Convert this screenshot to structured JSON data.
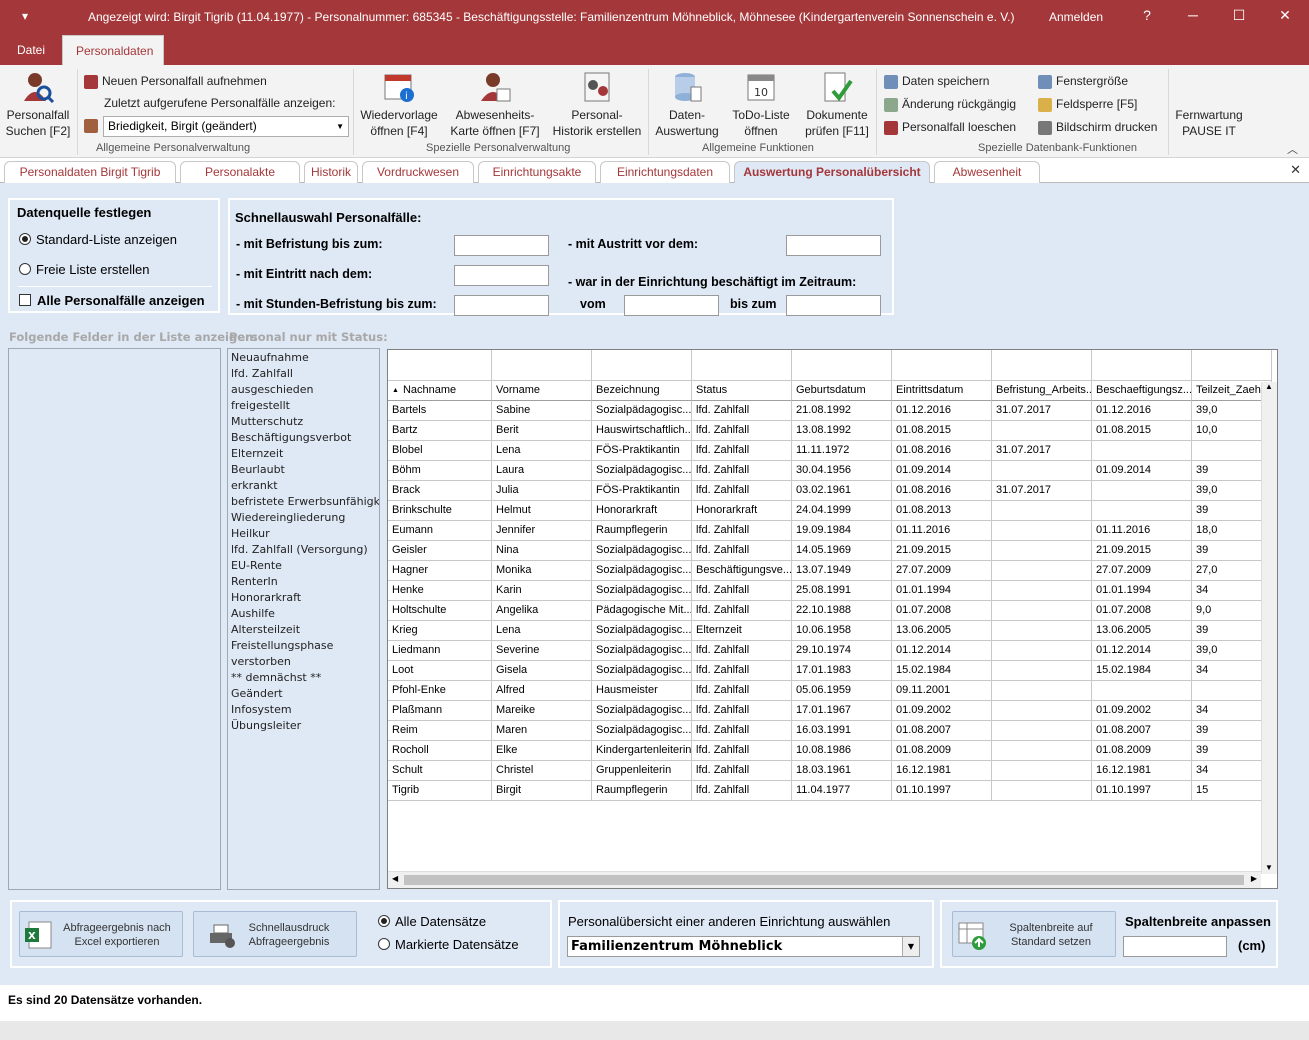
{
  "titlebar": {
    "quick_access": "▾",
    "title": "Angezeigt wird: Birgit Tigrib (11.04.1977) - Personalnummer: 685345 - Beschäftigungsstelle: Familienzentrum Möhneblick, Möhnesee (Kindergartenverein Sonnenschein e. V.)",
    "login": "Anmelden",
    "help": "?",
    "minimize": "─",
    "maximize": "☐",
    "close": "✕"
  },
  "menu": {
    "datei": "Datei",
    "personaldaten": "Personaldaten"
  },
  "ribbon": {
    "personalfall_suchen": [
      "Personalfall",
      "Suchen [F2]"
    ],
    "neuen_personalfall": "Neuen Personalfall aufnehmen",
    "zuletzt": "Zuletzt aufgerufene Personalfälle anzeigen:",
    "combo_value": "Briedigkeit, Birgit (geändert)",
    "wiedervorlage": [
      "Wiedervorlage",
      "öffnen [F4]"
    ],
    "abwesenheit": [
      "Abwesenheits-",
      "Karte öffnen [F7]"
    ],
    "historik": [
      "Personal-",
      "Historik erstellen"
    ],
    "daten_auswertung": [
      "Daten-",
      "Auswertung"
    ],
    "todo": [
      "ToDo-Liste",
      "öffnen"
    ],
    "dokumente": [
      "Dokumente",
      "prüfen [F11]"
    ],
    "daten_speichern": "Daten speichern",
    "aenderung": "Änderung rückgängig",
    "loeschen": "Personalfall loeschen",
    "fenstergroesse": "Fenstergröße",
    "feldsperre": "Feldsperre [F5]",
    "bildschirm": "Bildschirm drucken",
    "fernwartung": [
      "Fernwartung",
      "PAUSE IT"
    ],
    "groups": {
      "allgemeine_personal": "Allgemeine Personalverwaltung",
      "spezielle_personal": "Spezielle Personalverwaltung",
      "allgemeine_funktionen": "Allgemeine Funktionen",
      "spezielle_db": "Spezielle Datenbank-Funktionen"
    }
  },
  "doctabs": [
    "Personaldaten Birgit Tigrib",
    "Personalakte",
    "Historik",
    "Vordruckwesen",
    "Einrichtungsakte",
    "Einrichtungsdaten",
    "Auswertung Personalübersicht",
    "Abwesenheit"
  ],
  "datenquelle": {
    "title": "Datenquelle festlegen",
    "standard": "Standard-Liste anzeigen",
    "frei": "Freie Liste erstellen",
    "alle": "Alle Personalfälle anzeigen"
  },
  "schnell": {
    "title": "Schnellauswahl Personalfälle:",
    "befristung": "- mit Befristung bis zum:",
    "eintritt": "- mit Eintritt nach dem:",
    "stunden": "- mit Stunden-Befristung bis zum:",
    "austritt": "- mit Austritt vor dem:",
    "zeitraum": "- war in der Einrichtung beschäftigt im Zeitraum:",
    "vom": "vom",
    "bis": "bis zum"
  },
  "felder_label": "Folgende Felder in der Liste anzeigen:",
  "status_label": "Personal nur mit Status:",
  "status_items": [
    "Neuaufnahme",
    "lfd. Zahlfall",
    "ausgeschieden",
    "freigestellt",
    "Mutterschutz",
    "Beschäftigungsverbot",
    "Elternzeit",
    "Beurlaubt",
    "erkrankt",
    "befristete Erwerbsunfähigk",
    "Wiedereingliederung",
    "Heilkur",
    "lfd. Zahlfall (Versorgung)",
    "EU-Rente",
    "RenterIn",
    "Honorarkraft",
    "Aushilfe",
    "Altersteilzeit",
    "Freistellungsphase",
    "verstorben",
    "** demnächst **",
    "Geändert",
    "Infosystem",
    "Übungsleiter"
  ],
  "table": {
    "sort_indicator": "▲",
    "columns": [
      "Nachname",
      "Vorname",
      "Bezeichnung",
      "Status",
      "Geburtsdatum",
      "Eintrittsdatum",
      "Befristung_Arbeits...",
      "Beschaeftigungsz...",
      "Teilzeit_Zaeh"
    ],
    "rows": [
      [
        "Bartels",
        "Sabine",
        "Sozialpädagogisc...",
        "lfd. Zahlfall",
        "21.08.1992",
        "01.12.2016",
        "31.07.2017",
        "01.12.2016",
        "39,0"
      ],
      [
        "Bartz",
        "Berit",
        "Hauswirtschaftlich...",
        "lfd. Zahlfall",
        "13.08.1992",
        "01.08.2015",
        "",
        "01.08.2015",
        "10,0"
      ],
      [
        "Blobel",
        "Lena",
        "FÖS-Praktikantin",
        "lfd. Zahlfall",
        "11.11.1972",
        "01.08.2016",
        "31.07.2017",
        "",
        ""
      ],
      [
        "Böhm",
        "Laura",
        "Sozialpädagogisc...",
        "lfd. Zahlfall",
        "30.04.1956",
        "01.09.2014",
        "",
        "01.09.2014",
        "39"
      ],
      [
        "Brack",
        "Julia",
        "FÖS-Praktikantin",
        "lfd. Zahlfall",
        "03.02.1961",
        "01.08.2016",
        "31.07.2017",
        "",
        "39,0"
      ],
      [
        "Brinkschulte",
        "Helmut",
        "Honorarkraft",
        "Honorarkraft",
        "24.04.1999",
        "01.08.2013",
        "",
        "",
        "39"
      ],
      [
        "Eumann",
        "Jennifer",
        "Raumpflegerin",
        "lfd. Zahlfall",
        "19.09.1984",
        "01.11.2016",
        "",
        "01.11.2016",
        "18,0"
      ],
      [
        "Geisler",
        "Nina",
        "Sozialpädagogisc...",
        "lfd. Zahlfall",
        "14.05.1969",
        "21.09.2015",
        "",
        "21.09.2015",
        "39"
      ],
      [
        "Hagner",
        "Monika",
        "Sozialpädagogisc...",
        "Beschäftigungsve...",
        "13.07.1949",
        "27.07.2009",
        "",
        "27.07.2009",
        "27,0"
      ],
      [
        "Henke",
        "Karin",
        "Sozialpädagogisc...",
        "lfd. Zahlfall",
        "25.08.1991",
        "01.01.1994",
        "",
        "01.01.1994",
        "34"
      ],
      [
        "Holtschulte",
        "Angelika",
        "Pädagogische Mit...",
        "lfd. Zahlfall",
        "22.10.1988",
        "01.07.2008",
        "",
        "01.07.2008",
        "9,0"
      ],
      [
        "Krieg",
        "Lena",
        "Sozialpädagogisc...",
        "Elternzeit",
        "10.06.1958",
        "13.06.2005",
        "",
        "13.06.2005",
        "39"
      ],
      [
        "Liedmann",
        "Severine",
        "Sozialpädagogisc...",
        "lfd. Zahlfall",
        "29.10.1974",
        "01.12.2014",
        "",
        "01.12.2014",
        "39,0"
      ],
      [
        "Loot",
        "Gisela",
        "Sozialpädagogisc...",
        "lfd. Zahlfall",
        "17.01.1983",
        "15.02.1984",
        "",
        "15.02.1984",
        "34"
      ],
      [
        "Pfohl-Enke",
        "Alfred",
        "Hausmeister",
        "lfd. Zahlfall",
        "05.06.1959",
        "09.11.2001",
        "",
        "",
        ""
      ],
      [
        "Plaßmann",
        "Mareike",
        "Sozialpädagogisc...",
        "lfd. Zahlfall",
        "17.01.1967",
        "01.09.2002",
        "",
        "01.09.2002",
        "34"
      ],
      [
        "Reim",
        "Maren",
        "Sozialpädagogisc...",
        "lfd. Zahlfall",
        "16.03.1991",
        "01.08.2007",
        "",
        "01.08.2007",
        "39"
      ],
      [
        "Rocholl",
        "Elke",
        "Kindergartenleiterin",
        "lfd. Zahlfall",
        "10.08.1986",
        "01.08.2009",
        "",
        "01.08.2009",
        "39"
      ],
      [
        "Schult",
        "Christel",
        "Gruppenleiterin",
        "lfd. Zahlfall",
        "18.03.1961",
        "16.12.1981",
        "",
        "16.12.1981",
        "34"
      ],
      [
        "Tigrib",
        "Birgit",
        "Raumpflegerin",
        "lfd. Zahlfall",
        "11.04.1977",
        "01.10.1997",
        "",
        "01.10.1997",
        "15"
      ]
    ]
  },
  "bottom": {
    "excel": [
      "Abfrageergebnis nach",
      "Excel exportieren"
    ],
    "druck": [
      "Schnellausdruck",
      "Abfrageergebnis"
    ],
    "alle_ds": "Alle Datensätze",
    "markierte_ds": "Markierte Datensätze",
    "andere_label": "Personalübersicht einer anderen Einrichtung auswählen",
    "einrichtung_value": "Familienzentrum Möhneblick",
    "spaltenbreite_btn": [
      "Spaltenbreite auf",
      "Standard setzen"
    ],
    "spaltenbreite_label": "Spaltenbreite anpassen",
    "cm": "(cm)"
  },
  "status_text": "Es sind 20 Datensätze vorhanden.",
  "colors": {
    "accent": "#a4373a",
    "panel_bg": "#dfe8f5",
    "button_bg": "#d5e2f2"
  }
}
